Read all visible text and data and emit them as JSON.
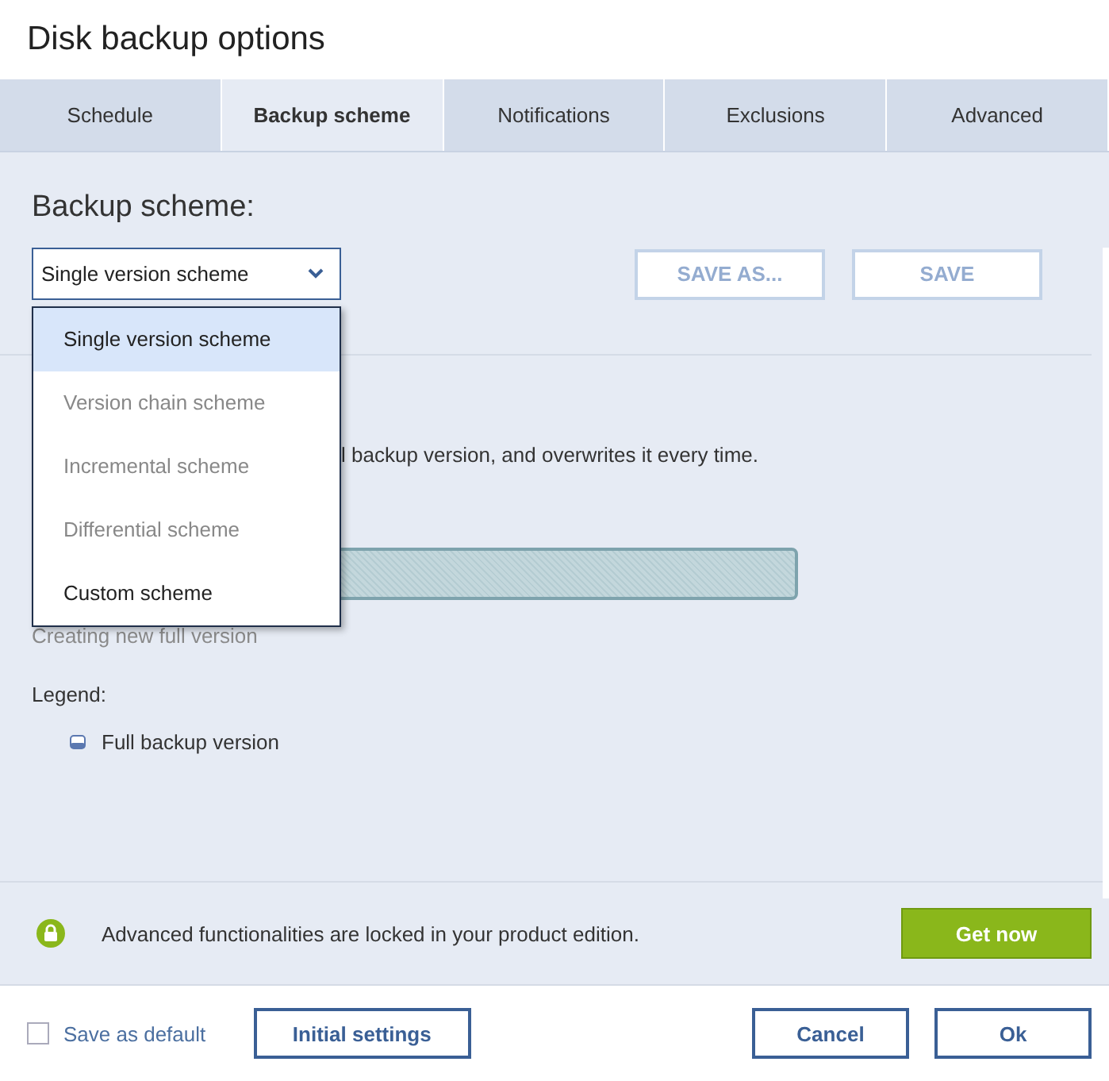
{
  "window": {
    "title": "Disk backup options"
  },
  "tabs": [
    {
      "label": "Schedule",
      "selected": false
    },
    {
      "label": "Backup scheme",
      "selected": true
    },
    {
      "label": "Notifications",
      "selected": false
    },
    {
      "label": "Exclusions",
      "selected": false
    },
    {
      "label": "Advanced",
      "selected": false
    }
  ],
  "scheme": {
    "heading": "Backup scheme:",
    "select": {
      "value": "Single version scheme",
      "expanded": true
    },
    "buttons": [
      {
        "label": "SAVE AS...",
        "disabled": true
      },
      {
        "label": "SAVE",
        "disabled": true
      }
    ],
    "options": [
      {
        "label": "Single version scheme",
        "selected": true,
        "disabled": false
      },
      {
        "label": "Version chain scheme",
        "selected": false,
        "disabled": true
      },
      {
        "label": "Incremental scheme",
        "selected": false,
        "disabled": true
      },
      {
        "label": "Differential scheme",
        "selected": false,
        "disabled": true
      },
      {
        "label": "Custom scheme",
        "selected": false,
        "disabled": false
      }
    ]
  },
  "description": "l backup version, and overwrites it every time.",
  "timeline": {
    "caption": "Creating new full version"
  },
  "legend": {
    "title": "Legend:",
    "items": [
      {
        "label": "Full backup version"
      }
    ]
  },
  "banner": {
    "text": "Advanced functionalities are locked in your product edition.",
    "button": "Get now"
  },
  "footer": {
    "save_as_default": {
      "label": "Save as default",
      "checked": false
    },
    "buttons": [
      "Initial settings",
      "Cancel",
      "Ok"
    ]
  }
}
